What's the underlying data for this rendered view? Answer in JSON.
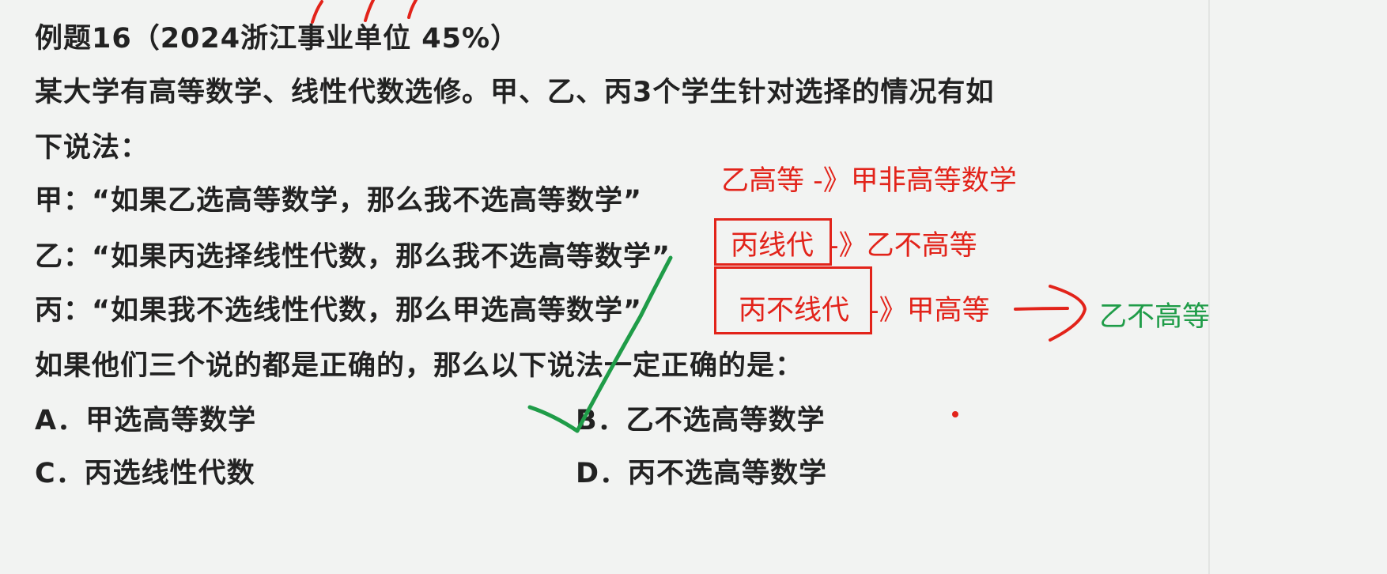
{
  "title": "例题16（2024浙江事业单位 45%）",
  "stem": {
    "line1": "某大学有高等数学、线性代数选修。甲、乙、丙3个学生针对选择的情况有如",
    "line2": "下说法："
  },
  "statements": [
    {
      "text": "甲：“如果乙选高等数学，那么我不选高等数学”"
    },
    {
      "text": "乙：“如果丙选择线性代数，那么我不选高等数学”"
    },
    {
      "text": "丙：“如果我不选线性代数，那么甲选高等数学”"
    }
  ],
  "question": "如果他们三个说的都是正确的，那么以下说法一定正确的是：",
  "options": {
    "A": "A．甲选高等数学",
    "B": "B．乙不选高等数学",
    "C": "C．丙选线性代数",
    "D": "D．丙不选高等数学"
  },
  "annotations": {
    "note1": "乙高等 -》甲非高等数学",
    "note2_box": "丙线代",
    "note2_rest": "-》乙不高等",
    "note3_box": "丙不线代",
    "note3_rest": "-》甲高等",
    "note3_result": "乙不高等"
  },
  "colors": {
    "annotation_red": "#e2231a",
    "annotation_green": "#1f9c48",
    "text": "#222222",
    "background": "#f2f3f2"
  }
}
